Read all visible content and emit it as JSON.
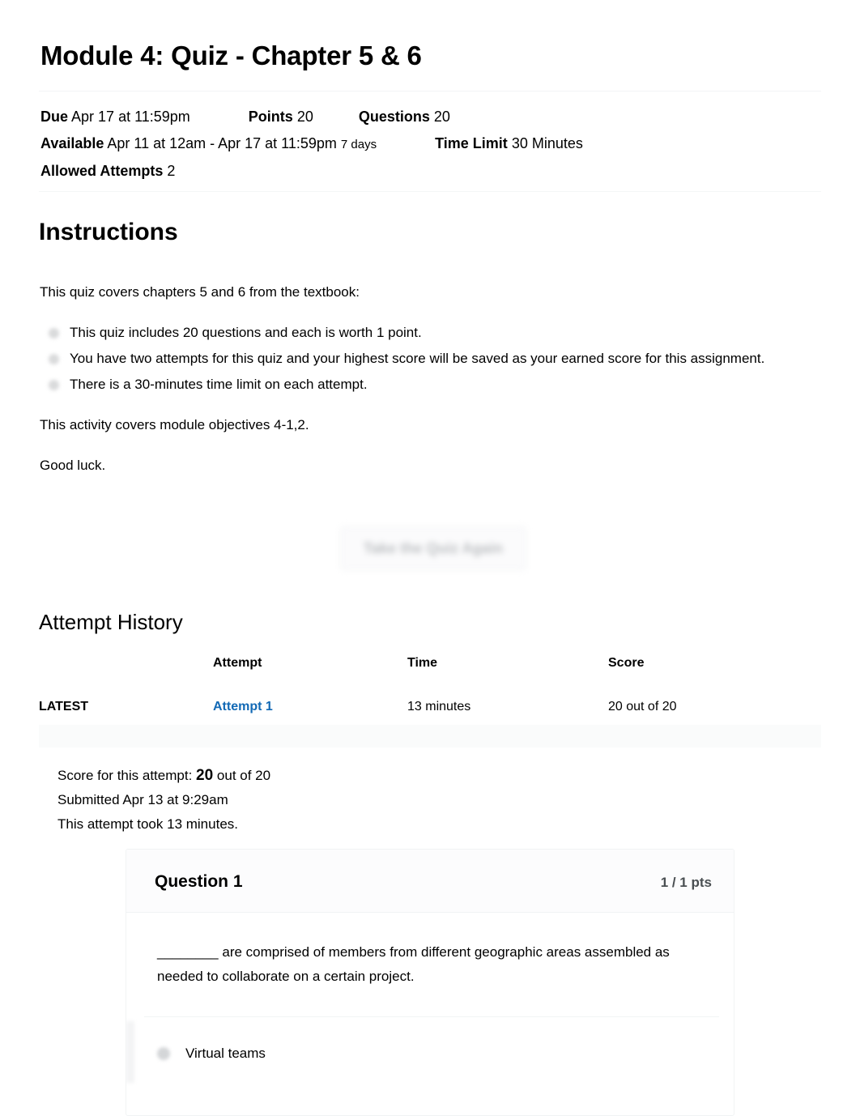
{
  "quiz": {
    "title": "Module 4: Quiz - Chapter 5 & 6",
    "meta": {
      "due_label": "Due",
      "due_value": "Apr 17 at 11:59pm",
      "points_label": "Points",
      "points_value": "20",
      "questions_label": "Questions",
      "questions_value": "20",
      "available_label": "Available",
      "available_value": "Apr 11 at 12am - Apr 17 at 11:59pm",
      "available_duration": "7 days",
      "time_limit_label": "Time Limit",
      "time_limit_value": "30 Minutes",
      "allowed_attempts_label": "Allowed Attempts",
      "allowed_attempts_value": "2"
    }
  },
  "instructions": {
    "heading": "Instructions",
    "intro": "This quiz covers chapters 5 and 6 from the textbook:",
    "bullets": [
      "This quiz includes 20 questions and each is worth 1 point.",
      "You have two attempts for this quiz and your highest score will be saved as your earned score for this assignment.",
      "There is a 30-minutes time limit on each attempt."
    ],
    "objectives": "This activity covers module objectives 4-1,2.",
    "closing": "Good luck."
  },
  "actions": {
    "take_quiz_again": "Take the Quiz Again"
  },
  "attempt_history": {
    "heading": "Attempt History",
    "columns": [
      "",
      "Attempt",
      "Time",
      "Score"
    ],
    "rows": [
      {
        "badge": "LATEST",
        "attempt": "Attempt 1",
        "time": "13 minutes",
        "score": "20 out of 20"
      }
    ]
  },
  "attempt_summary": {
    "score_prefix": "Score for this attempt:",
    "score_value": "20",
    "score_suffix": "out of 20",
    "submitted": "Submitted Apr 13 at 9:29am",
    "duration": "This attempt took 13 minutes."
  },
  "question": {
    "name": "Question 1",
    "points": "1 / 1 pts",
    "text": "________ are comprised of members from different geographic areas assembled as needed to collaborate on a certain project.",
    "answers": [
      {
        "label": "Virtual teams"
      }
    ]
  },
  "colors": {
    "link": "#1269b5",
    "text": "#000000",
    "muted": "#4a4f52"
  }
}
